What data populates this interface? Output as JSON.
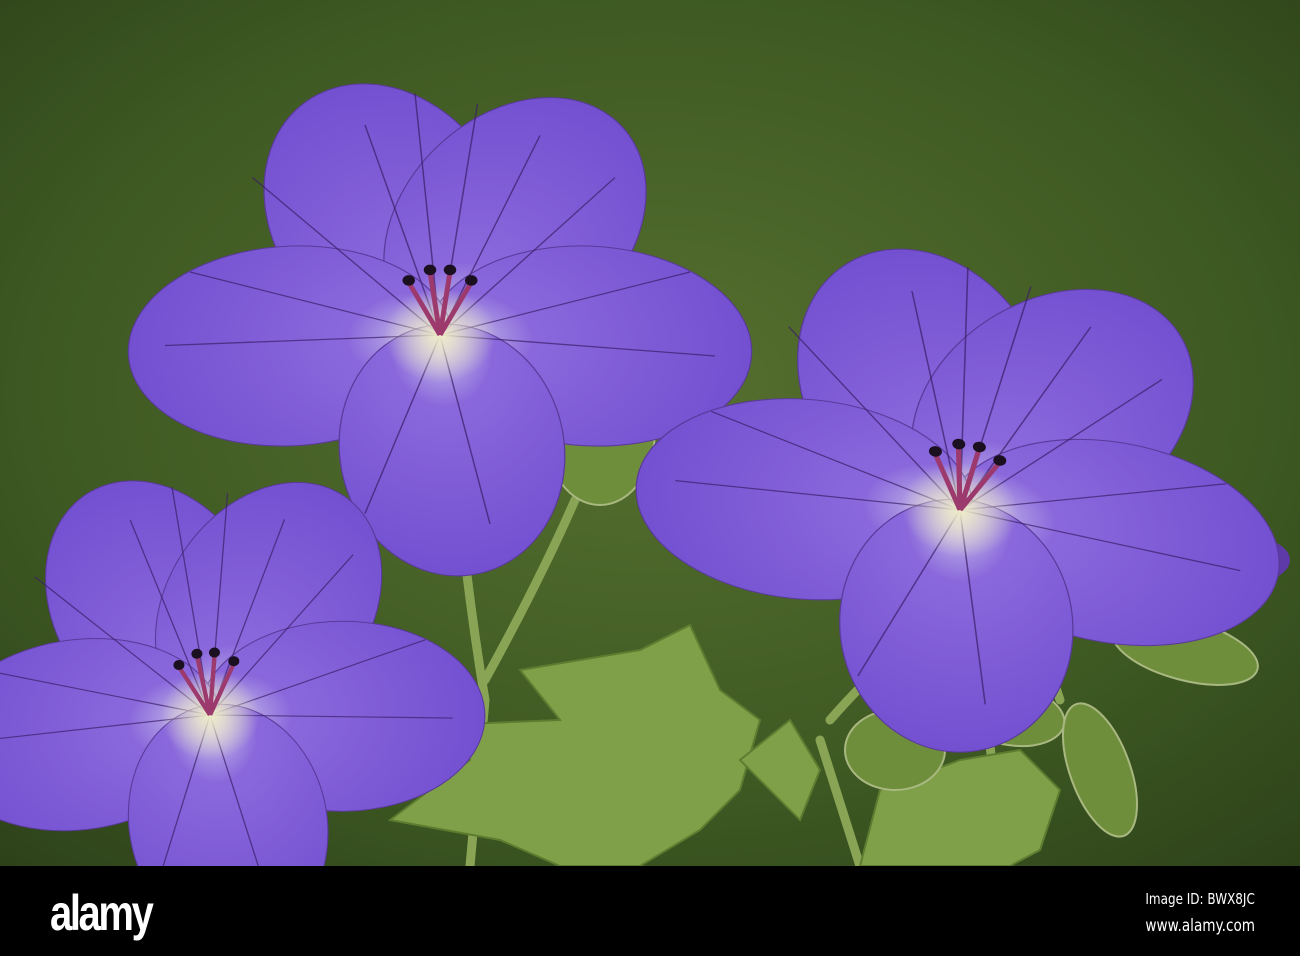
{
  "photo": {
    "subject": "purple geranium flowers",
    "colors": {
      "background": "#4a6428",
      "petal": "#7d5ad8",
      "vein": "#3b1e66",
      "leaf": "#7fa048"
    }
  },
  "footer": {
    "logo": "alamy",
    "image_id": "Image ID: BWX8JC",
    "website": "www.alamy.com"
  }
}
